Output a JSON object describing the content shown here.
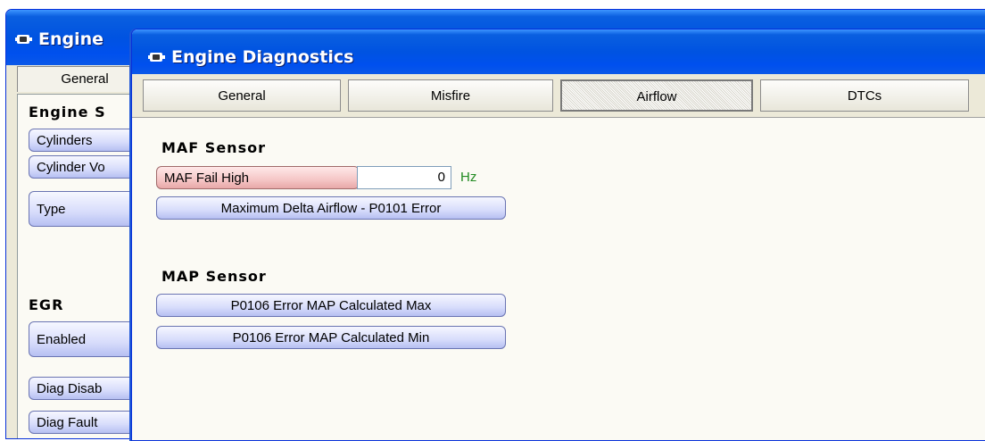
{
  "back_window": {
    "title": "Engine",
    "tab_label": "General",
    "sections": [
      {
        "heading": "Engine S",
        "buttons": [
          "Cylinders",
          "Cylinder Vo",
          "Type"
        ]
      },
      {
        "heading": "EGR",
        "buttons": [
          "Enabled",
          "Diag Disab",
          "Diag Fault"
        ]
      }
    ]
  },
  "front_window": {
    "title": "Engine Diagnostics",
    "tabs": [
      "General",
      "Misfire",
      "Airflow",
      "DTCs"
    ],
    "active_tab": "Airflow",
    "maf": {
      "heading": "MAF Sensor",
      "fail_high_label": "MAF Fail High",
      "fail_high_value": "0",
      "fail_high_unit": "Hz",
      "delta_button": "Maximum Delta Airflow - P0101 Error"
    },
    "map": {
      "heading": "MAP Sensor",
      "max_button": "P0106 Error MAP Calculated Max",
      "min_button": "P0106 Error MAP Calculated Min"
    }
  },
  "colors": {
    "titlebar": "#0053e1",
    "button_blue": "#d7dcfb",
    "button_red": "#f5c6c6",
    "unit_green": "#228b22"
  }
}
